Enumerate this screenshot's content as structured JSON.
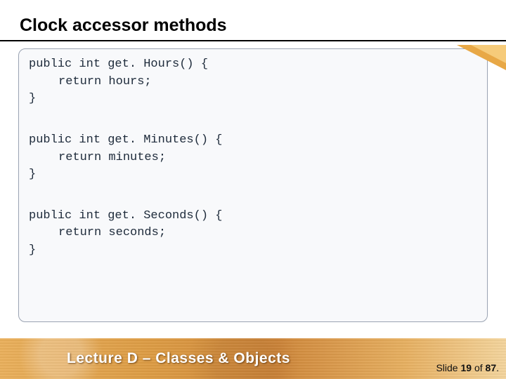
{
  "title": "Clock accessor methods",
  "code": {
    "l1": "public int get. Hours() {",
    "l2": "return hours;",
    "l3": "}",
    "l4": "public int get. Minutes() {",
    "l5": "return minutes;",
    "l6": "}",
    "l7": "public int get. Seconds() {",
    "l8": "return seconds;",
    "l9": "}"
  },
  "footer": {
    "lecture": "Lecture D – Classes & Objects",
    "slide_prefix": "Slide ",
    "slide_current": "19",
    "slide_of": " of ",
    "slide_total": "87",
    "slide_suffix": "."
  }
}
